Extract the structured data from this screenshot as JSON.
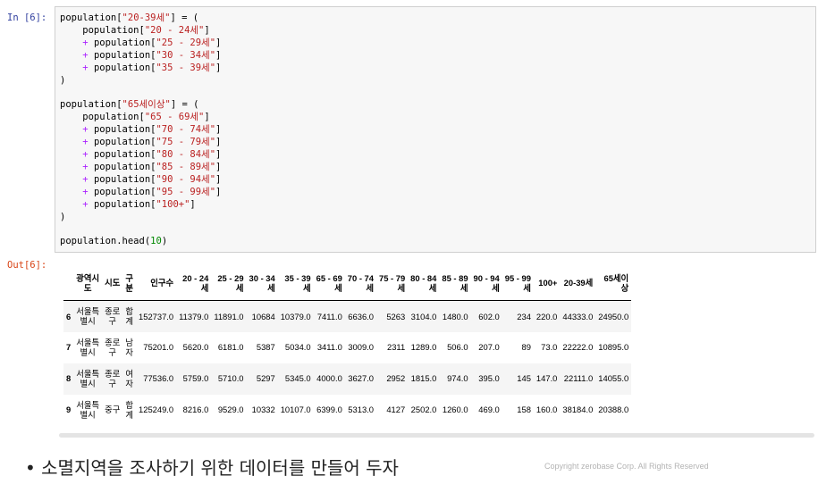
{
  "in_prompt": "In [6]:",
  "out_prompt": "Out[6]:",
  "code_lines": [
    [
      {
        "t": "population["
      },
      {
        "t": "\"20-39세\"",
        "c": "s"
      },
      {
        "t": "] = ("
      }
    ],
    [
      {
        "t": "    population["
      },
      {
        "t": "\"20 - 24세\"",
        "c": "s"
      },
      {
        "t": "]"
      }
    ],
    [
      {
        "t": "    "
      },
      {
        "t": "+",
        "c": "o"
      },
      {
        "t": " population["
      },
      {
        "t": "\"25 - 29세\"",
        "c": "s"
      },
      {
        "t": "]"
      }
    ],
    [
      {
        "t": "    "
      },
      {
        "t": "+",
        "c": "o"
      },
      {
        "t": " population["
      },
      {
        "t": "\"30 - 34세\"",
        "c": "s"
      },
      {
        "t": "]"
      }
    ],
    [
      {
        "t": "    "
      },
      {
        "t": "+",
        "c": "o"
      },
      {
        "t": " population["
      },
      {
        "t": "\"35 - 39세\"",
        "c": "s"
      },
      {
        "t": "]"
      }
    ],
    [
      {
        "t": ")"
      }
    ],
    [
      {
        "t": ""
      }
    ],
    [
      {
        "t": "population["
      },
      {
        "t": "\"65세이상\"",
        "c": "s"
      },
      {
        "t": "] = ("
      }
    ],
    [
      {
        "t": "    population["
      },
      {
        "t": "\"65 - 69세\"",
        "c": "s"
      },
      {
        "t": "]"
      }
    ],
    [
      {
        "t": "    "
      },
      {
        "t": "+",
        "c": "o"
      },
      {
        "t": " population["
      },
      {
        "t": "\"70 - 74세\"",
        "c": "s"
      },
      {
        "t": "]"
      }
    ],
    [
      {
        "t": "    "
      },
      {
        "t": "+",
        "c": "o"
      },
      {
        "t": " population["
      },
      {
        "t": "\"75 - 79세\"",
        "c": "s"
      },
      {
        "t": "]"
      }
    ],
    [
      {
        "t": "    "
      },
      {
        "t": "+",
        "c": "o"
      },
      {
        "t": " population["
      },
      {
        "t": "\"80 - 84세\"",
        "c": "s"
      },
      {
        "t": "]"
      }
    ],
    [
      {
        "t": "    "
      },
      {
        "t": "+",
        "c": "o"
      },
      {
        "t": " population["
      },
      {
        "t": "\"85 - 89세\"",
        "c": "s"
      },
      {
        "t": "]"
      }
    ],
    [
      {
        "t": "    "
      },
      {
        "t": "+",
        "c": "o"
      },
      {
        "t": " population["
      },
      {
        "t": "\"90 - 94세\"",
        "c": "s"
      },
      {
        "t": "]"
      }
    ],
    [
      {
        "t": "    "
      },
      {
        "t": "+",
        "c": "o"
      },
      {
        "t": " population["
      },
      {
        "t": "\"95 - 99세\"",
        "c": "s"
      },
      {
        "t": "]"
      }
    ],
    [
      {
        "t": "    "
      },
      {
        "t": "+",
        "c": "o"
      },
      {
        "t": " population["
      },
      {
        "t": "\"100+\"",
        "c": "s"
      },
      {
        "t": "]"
      }
    ],
    [
      {
        "t": ")"
      }
    ],
    [
      {
        "t": ""
      }
    ],
    [
      {
        "t": "population.head("
      },
      {
        "t": "10",
        "c": "n"
      },
      {
        "t": ")"
      }
    ]
  ],
  "table": {
    "columns": [
      {
        "text": "",
        "key": "index"
      },
      {
        "text": "광역시\n도",
        "key": "region"
      },
      {
        "text": "시도",
        "key": "city"
      },
      {
        "text": "구\n분",
        "key": "category"
      },
      {
        "text": "인구수",
        "key": "total"
      },
      {
        "text": "20 - 24\n세",
        "key": "a20"
      },
      {
        "text": "25 - 29\n세",
        "key": "a25"
      },
      {
        "text": "30 - 34\n세",
        "key": "a30"
      },
      {
        "text": "35 - 39\n세",
        "key": "a35"
      },
      {
        "text": "65 - 69\n세",
        "key": "a65"
      },
      {
        "text": "70 - 74\n세",
        "key": "a70"
      },
      {
        "text": "75 - 79\n세",
        "key": "a75"
      },
      {
        "text": "80 - 84\n세",
        "key": "a80"
      },
      {
        "text": "85 - 89\n세",
        "key": "a85"
      },
      {
        "text": "90 - 94\n세",
        "key": "a90"
      },
      {
        "text": "95 - 99\n세",
        "key": "a95"
      },
      {
        "text": "100+",
        "key": "a100"
      },
      {
        "text": "20-39세",
        "key": "young"
      },
      {
        "text": "65세이\n상",
        "key": "old"
      }
    ],
    "rows": [
      [
        "6",
        "서울특\n별시",
        "종로\n구",
        "합\n계",
        "152737.0",
        "11379.0",
        "11891.0",
        "10684",
        "10379.0",
        "7411.0",
        "6636.0",
        "5263",
        "3104.0",
        "1480.0",
        "602.0",
        "234",
        "220.0",
        "44333.0",
        "24950.0"
      ],
      [
        "7",
        "서울특\n별시",
        "종로\n구",
        "남\n자",
        "75201.0",
        "5620.0",
        "6181.0",
        "5387",
        "5034.0",
        "3411.0",
        "3009.0",
        "2311",
        "1289.0",
        "506.0",
        "207.0",
        "89",
        "73.0",
        "22222.0",
        "10895.0"
      ],
      [
        "8",
        "서울특\n별시",
        "종로\n구",
        "여\n자",
        "77536.0",
        "5759.0",
        "5710.0",
        "5297",
        "5345.0",
        "4000.0",
        "3627.0",
        "2952",
        "1815.0",
        "974.0",
        "395.0",
        "145",
        "147.0",
        "22111.0",
        "14055.0"
      ],
      [
        "9",
        "서울특\n별시",
        "중구",
        "합\n계",
        "125249.0",
        "8216.0",
        "9529.0",
        "10332",
        "10107.0",
        "6399.0",
        "5313.0",
        "4127",
        "2502.0",
        "1260.0",
        "469.0",
        "158",
        "160.0",
        "38184.0",
        "20388.0"
      ]
    ]
  },
  "bullet_text": "• 소멸지역을 조사하기 위한 데이터를 만들어 두자",
  "copyright": "Copyright zerobase Corp. All Rights Reserved"
}
